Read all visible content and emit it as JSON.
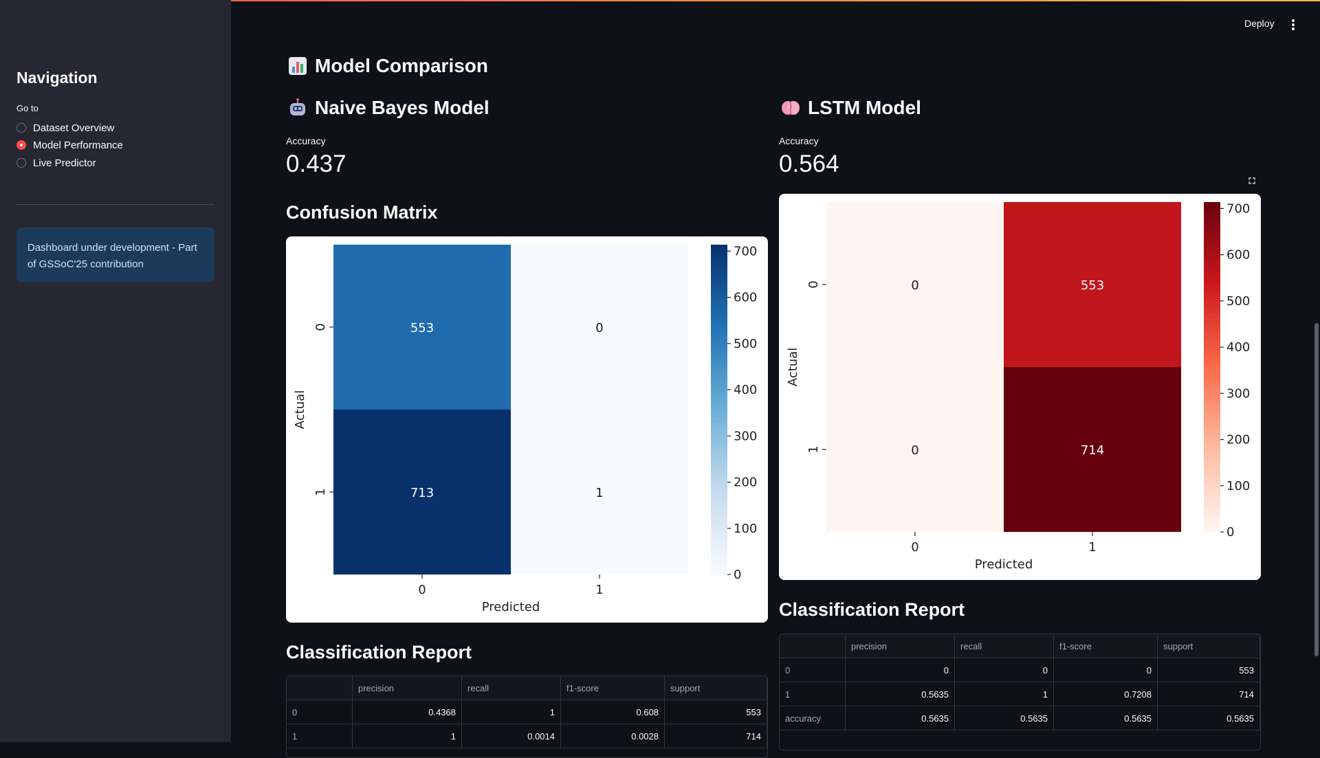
{
  "header": {
    "deploy_label": "Deploy"
  },
  "sidebar": {
    "title": "Navigation",
    "goto_label": "Go to",
    "options": [
      "Dataset Overview",
      "Model Performance",
      "Live Predictor"
    ],
    "selected": "Model Performance",
    "info_text": "Dashboard under development - Part of GSSoC'25 contribution"
  },
  "main": {
    "title": "Model Comparison",
    "title_icon": "bar-chart-icon",
    "nb": {
      "title": "Naive Bayes Model",
      "title_icon": "robot-icon",
      "accuracy_label": "Accuracy",
      "accuracy_value": "0.437",
      "cm_title": "Confusion Matrix",
      "report_title": "Classification Report",
      "report": {
        "columns": [
          "",
          "precision",
          "recall",
          "f1-score",
          "support"
        ],
        "rows": [
          [
            "0",
            "0.4368",
            "1",
            "0.608",
            "553"
          ],
          [
            "1",
            "1",
            "0.0014",
            "0.0028",
            "714"
          ]
        ]
      }
    },
    "lstm": {
      "title": "LSTM Model",
      "title_icon": "brain-icon",
      "accuracy_label": "Accuracy",
      "accuracy_value": "0.564",
      "report_title": "Classification Report",
      "report": {
        "columns": [
          "",
          "precision",
          "recall",
          "f1-score",
          "support"
        ],
        "rows": [
          [
            "0",
            "0",
            "0",
            "0",
            "553"
          ],
          [
            "1",
            "0.5635",
            "1",
            "0.7208",
            "714"
          ],
          [
            "accuracy",
            "0.5635",
            "0.5635",
            "0.5635",
            "0.5635"
          ]
        ]
      }
    }
  },
  "chart_data": [
    {
      "type": "heatmap",
      "title": "",
      "xlabel": "Predicted",
      "ylabel": "Actual",
      "x_categories": [
        "0",
        "1"
      ],
      "y_categories": [
        "0",
        "1"
      ],
      "values": [
        [
          553,
          0
        ],
        [
          713,
          1
        ]
      ],
      "colormap": "Blues",
      "colorbar_ticks": [
        0,
        100,
        200,
        300,
        400,
        500,
        600,
        700
      ],
      "vmin": 0,
      "vmax": 714
    },
    {
      "type": "heatmap",
      "title": "",
      "xlabel": "Predicted",
      "ylabel": "Actual",
      "x_categories": [
        "0",
        "1"
      ],
      "y_categories": [
        "0",
        "1"
      ],
      "values": [
        [
          0,
          553
        ],
        [
          0,
          714
        ]
      ],
      "colormap": "Reds",
      "colorbar_ticks": [
        0,
        100,
        200,
        300,
        400,
        500,
        600,
        700
      ],
      "vmin": 0,
      "vmax": 714
    }
  ]
}
